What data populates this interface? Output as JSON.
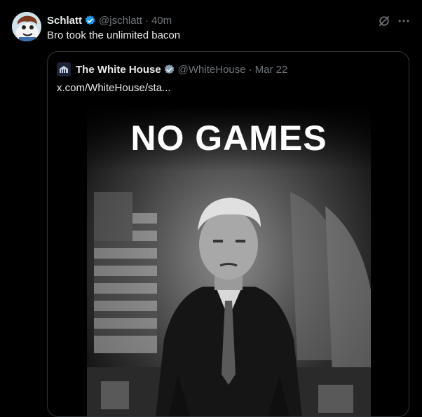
{
  "tweet": {
    "author": {
      "name": "Schlatt",
      "handle": "@jschlatt",
      "verified": true,
      "avatar_icon": "cartoon-avatar"
    },
    "separator": "·",
    "time": "40m",
    "text": "Bro took the unlimited bacon",
    "actions": {
      "grok_icon": "grok-icon",
      "more_icon": "more-icon"
    }
  },
  "quoted_tweet": {
    "author": {
      "name": "The White House",
      "handle": "@WhiteHouse",
      "badge": "gov-verified-grey",
      "avatar_icon": "white-house-logo"
    },
    "separator": "·",
    "date": "Mar 22",
    "link_text": "x.com/WhiteHouse/sta...",
    "media": {
      "caption": "NO GAMES",
      "style": "black-and-white photo"
    }
  },
  "colors": {
    "background": "#000000",
    "text": "#e7e9ea",
    "secondary": "#71767b",
    "border": "#2f3336",
    "verified_blue": "#1d9bf0",
    "gov_grey": "#829aab"
  }
}
